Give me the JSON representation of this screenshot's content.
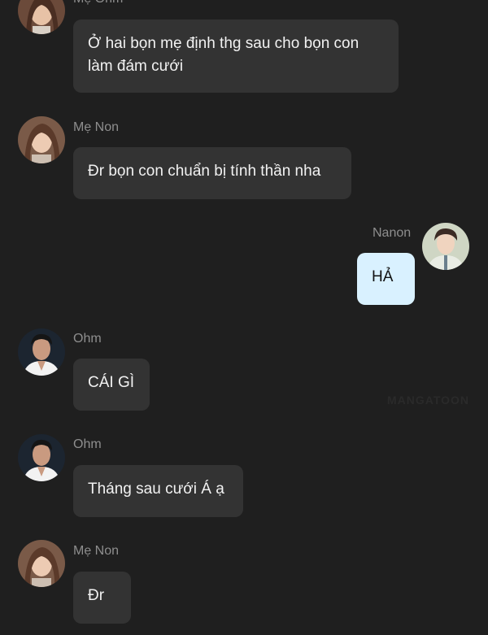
{
  "messages": [
    {
      "sender": "Mẹ Ohm",
      "text": "Ở hai bọn mẹ định thg  sau cho bọn con làm đám cưới",
      "avatar": "woman-avatar"
    },
    {
      "sender": "Mẹ Non",
      "text": "Đr bọn con chuẩn bị tính thần nha",
      "avatar": "woman-avatar"
    },
    {
      "sender": "Nanon",
      "text": "HẢ",
      "avatar": "young-man-avatar"
    },
    {
      "sender": "Ohm",
      "text": "CÁI GÌ",
      "avatar": "man-avatar"
    },
    {
      "sender": "Ohm",
      "text": "Tháng sau cưới Á ạ",
      "avatar": "man-avatar"
    },
    {
      "sender": "Mẹ Non",
      "text": "Đr",
      "avatar": "woman-avatar"
    }
  ],
  "watermark": "MANGATOON",
  "colors": {
    "background": "#1f1f1f",
    "incoming_bubble": "#333333",
    "outgoing_bubble": "#d9f1ff",
    "sender_name": "#8e8e8e"
  }
}
